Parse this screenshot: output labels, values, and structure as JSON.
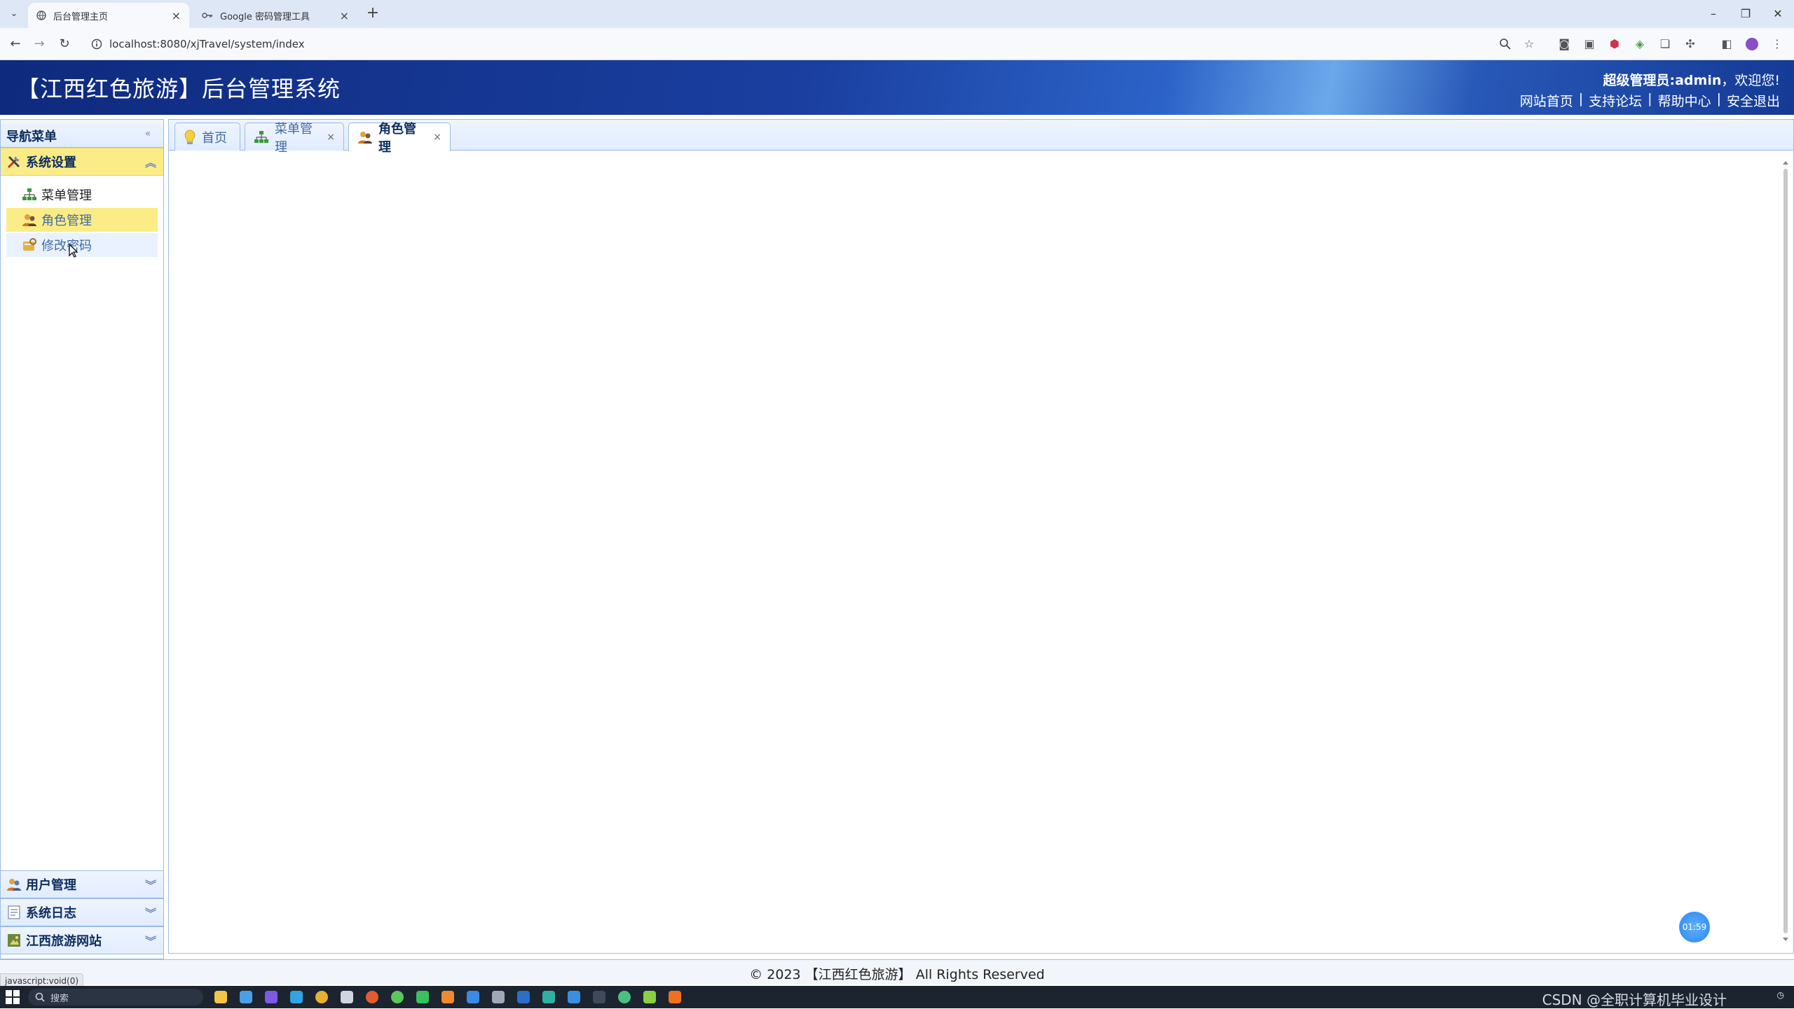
{
  "browser": {
    "tabs": [
      {
        "title": "后台管理主页",
        "active": true
      },
      {
        "title": "Google 密码管理工具",
        "active": false
      }
    ],
    "new_tab": "+",
    "address": "localhost:8080/xjTravel/system/index"
  },
  "header": {
    "title": "【江西红色旅游】后台管理系统",
    "welcome_bold": "超级管理员:admin",
    "welcome_rest": "，欢迎您!",
    "links": [
      "网站首页",
      "支持论坛",
      "帮助中心",
      "安全退出"
    ],
    "separator": "|"
  },
  "sidebar": {
    "title": "导航菜单",
    "groups": [
      {
        "label": "系统设置",
        "expanded": true,
        "items": [
          {
            "label": "菜单管理",
            "state": "normal"
          },
          {
            "label": "角色管理",
            "state": "active"
          },
          {
            "label": "修改密码",
            "state": "hover"
          }
        ]
      },
      {
        "label": "用户管理",
        "expanded": false
      },
      {
        "label": "系统日志",
        "expanded": false
      },
      {
        "label": "江西旅游网站",
        "expanded": false
      }
    ]
  },
  "content_tabs": [
    {
      "label": "首页",
      "closable": false,
      "active": false
    },
    {
      "label": "菜单管理",
      "closable": true,
      "active": false
    },
    {
      "label": "角色管理",
      "closable": true,
      "active": true
    }
  ],
  "close_glyph": "×",
  "timer": "01:59",
  "footer": {
    "text": "© 2023 【江西红色旅游】 All Rights Reserved"
  },
  "status_bar": {
    "url": "javascript:void(0)"
  },
  "taskbar": {
    "search_placeholder": "搜索",
    "watermark": "CSDN @全职计算机毕业设计"
  },
  "colors": {
    "header_dark": "#0e2a7e",
    "header_light": "#6aa8ea",
    "accent_yellow": "#fbec88",
    "panel_border": "#99bbe8"
  },
  "icons": [
    "search-icon",
    "star-icon",
    "lightbulb-icon",
    "sitemap-icon",
    "user-group-icon",
    "key-icon",
    "log-icon",
    "website-icon",
    "collapse-icon"
  ]
}
